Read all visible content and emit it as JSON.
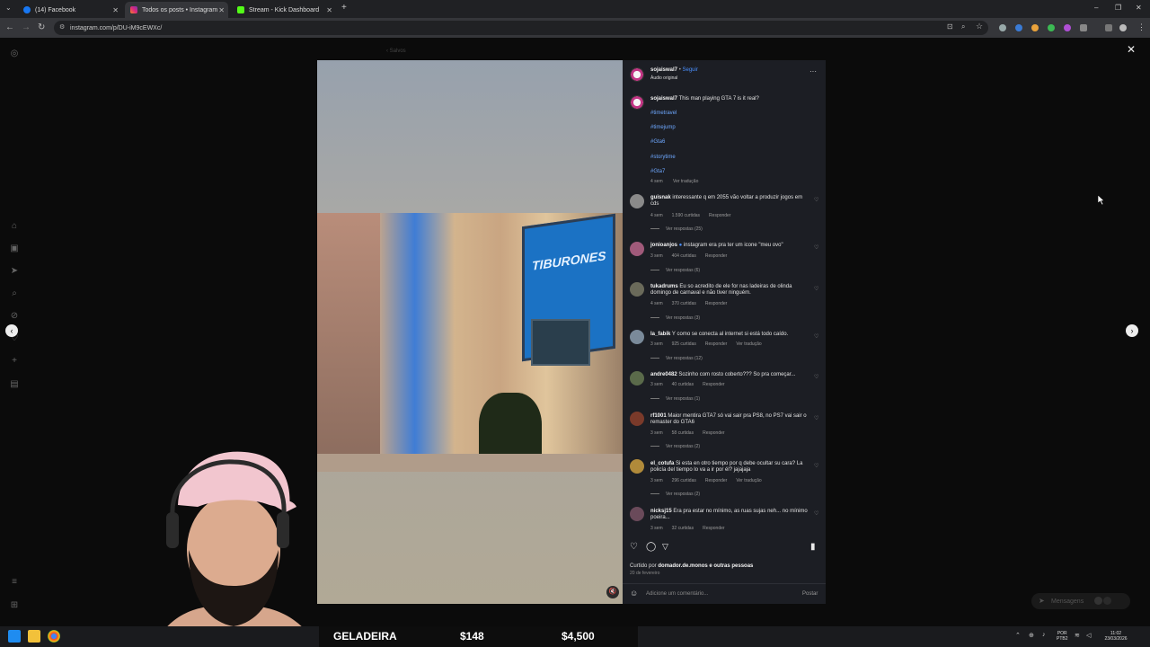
{
  "browser": {
    "tabs": [
      {
        "label": "(14) Facebook",
        "color": "#1877f2"
      },
      {
        "label": "Todos os posts • Instagram",
        "color": "#e1306c"
      },
      {
        "label": "Stream - Kick Dashboard",
        "color": "#53fc18"
      }
    ],
    "url": "instagram.com/p/DU-iM9cEWXc/",
    "new_tab": "+"
  },
  "page": {
    "breadcrumb": "Salvos",
    "close": "✕"
  },
  "post": {
    "author": "sojaiswal7",
    "follow": "Seguir",
    "audio": "Áudio original",
    "more": "···",
    "caption_user": "sojaiswal7",
    "caption_text": "This man playing GTA 7 is it real?",
    "hashtags": [
      "#timetravel",
      "#timejump",
      "#Gta6",
      "#storytime",
      "#Gta7"
    ],
    "caption_time": "4 sem",
    "caption_translate": "Ver tradução",
    "video_sign": "TIBURONES"
  },
  "comments": [
    {
      "user": "guisnak",
      "text": "interessante q em 2055 vão voltar a produzir jogos em cds",
      "time": "4 sem",
      "likes": "1.590 curtidas",
      "reply": "Responder",
      "extra": "",
      "replies": "Ver respostas (25)",
      "avatar": "#8a8a8a"
    },
    {
      "user": "jonioanjos",
      "text": "instagram era pra ter um icone \"meu ovo\"",
      "time": "3 sem",
      "likes": "404 curtidas",
      "reply": "Responder",
      "extra": "",
      "replies": "Ver respostas (6)",
      "avatar": "#a05a7a"
    },
    {
      "user": "tukadrums",
      "text": "Eu so acredito de ele for nas ladeiras de olinda domingo de carnaval e não tiver ninguém.",
      "time": "4 sem",
      "likes": "370 curtidas",
      "reply": "Responder",
      "extra": "",
      "replies": "Ver respostas (3)",
      "avatar": "#6a6a5a"
    },
    {
      "user": "la_fabik",
      "text": "Y como se conecta al internet si está todo caído.",
      "time": "3 sem",
      "likes": "925 curtidas",
      "reply": "Responder",
      "extra": "Ver tradução",
      "replies": "Ver respostas (12)",
      "avatar": "#7a8a9a"
    },
    {
      "user": "andre0482",
      "text": "Sozinho com rosto coberto??? So pra começar...",
      "time": "3 sem",
      "likes": "40 curtidas",
      "reply": "Responder",
      "extra": "",
      "replies": "Ver respostas (1)",
      "avatar": "#5a6a4a"
    },
    {
      "user": "rf1001",
      "text": "Maior mentira GTA7 só vai sair pra PS8, no PS7 vai sair o remaster do GTA6",
      "time": "3 sem",
      "likes": "58 curtidas",
      "reply": "Responder",
      "extra": "",
      "replies": "Ver respostas (2)",
      "avatar": "#7a3a2a"
    },
    {
      "user": "el_cotufa",
      "text": "Si esta en otro tiempo por q debe ocultar su cara? La policía del tiempo lo va a ir por él? jajajaja",
      "time": "3 sem",
      "likes": "296 curtidas",
      "reply": "Responder",
      "extra": "Ver tradução",
      "replies": "Ver respostas (2)",
      "avatar": "#b08a3a"
    },
    {
      "user": "nicksj15",
      "text": "Era pra estar no mínimo, as ruas sujas neh... no mínimo poeira...",
      "time": "3 sem",
      "likes": "32 curtidas",
      "reply": "Responder",
      "extra": "",
      "replies": "",
      "avatar": "#6a4a5a"
    }
  ],
  "footer": {
    "liked_prefix": "Curtido por",
    "liked_user": "domador.de.monos",
    "liked_suffix": "e outras pessoas",
    "date": "20 de fevereiro",
    "comment_placeholder": "Adicione um comentário...",
    "post_button": "Postar"
  },
  "messages": {
    "label": "Mensagens"
  },
  "stream_overlay": {
    "label1": "GELADEIRA",
    "label2": "$148",
    "label3": "$4,500"
  },
  "system_tray": {
    "lang1": "POR",
    "lang2": "PTB2",
    "time": "11:02",
    "date": "23/03/2026"
  },
  "colors": {
    "accent_link": "#6ea8ff",
    "panel_bg": "#1c1e24",
    "follow": "#4a90ff"
  }
}
